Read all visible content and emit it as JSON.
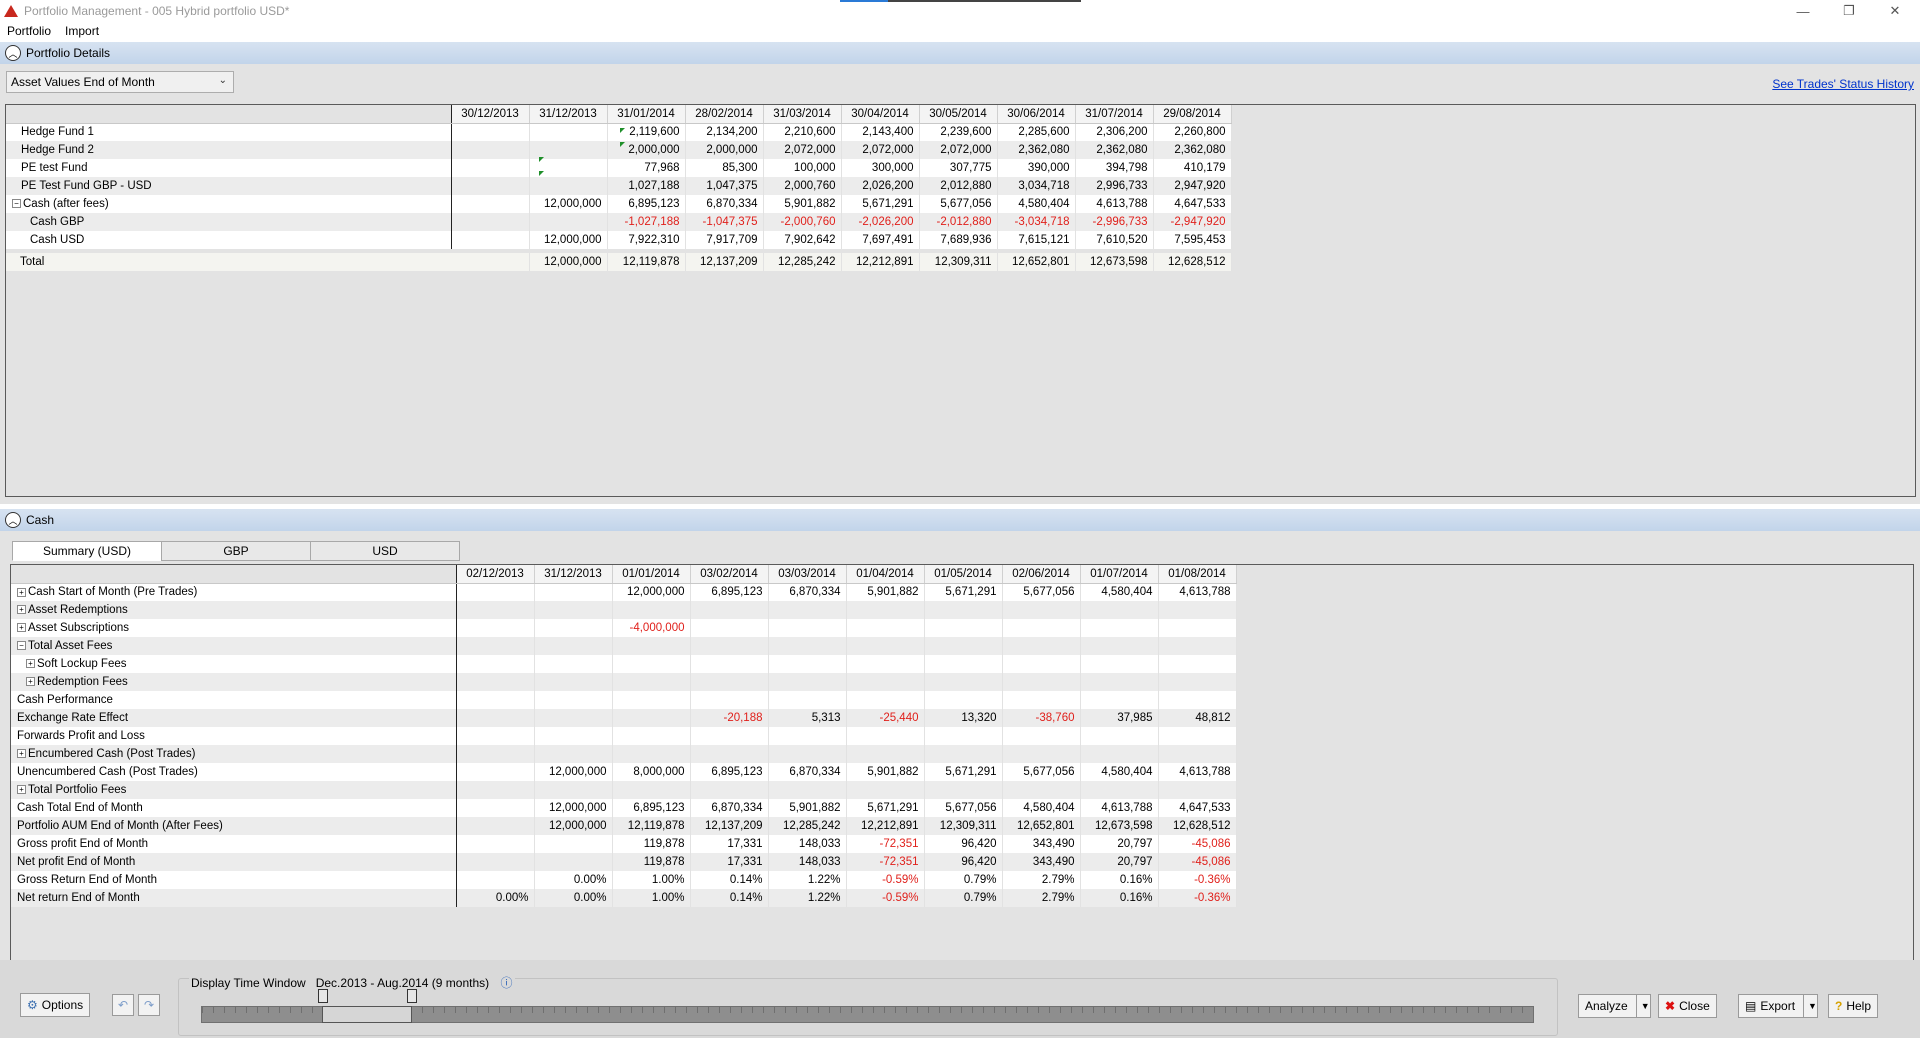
{
  "window": {
    "title": "Portfolio Management - 005 Hybrid portfolio USD*",
    "controls": {
      "minimize": "—",
      "restore": "❐",
      "close": "✕"
    }
  },
  "menu": [
    "Portfolio",
    "Import"
  ],
  "portfolio_details": {
    "header": "Portfolio Details",
    "dropdown_value": "Asset Values End of Month",
    "link": "See Trades' Status History",
    "columns": [
      "30/12/2013",
      "31/12/2013",
      "31/01/2014",
      "28/02/2014",
      "31/03/2014",
      "30/04/2014",
      "30/05/2014",
      "30/06/2014",
      "31/07/2014",
      "29/08/2014"
    ],
    "rows": [
      {
        "label": "Hedge Fund 1",
        "expander": "",
        "indent": 1,
        "values": [
          "",
          "",
          "2,119,600",
          "2,134,200",
          "2,210,600",
          "2,143,400",
          "2,239,600",
          "2,285,600",
          "2,306,200",
          "2,260,800"
        ],
        "neg": false
      },
      {
        "label": "Hedge Fund 2",
        "expander": "",
        "indent": 1,
        "values": [
          "",
          "",
          "2,000,000",
          "2,000,000",
          "2,072,000",
          "2,072,000",
          "2,072,000",
          "2,362,080",
          "2,362,080",
          "2,362,080"
        ],
        "neg": false
      },
      {
        "label": "PE test Fund",
        "expander": "",
        "indent": 1,
        "values": [
          "",
          "",
          "77,968",
          "85,300",
          "100,000",
          "300,000",
          "307,775",
          "390,000",
          "394,798",
          "410,179"
        ],
        "neg": false
      },
      {
        "label": "PE Test Fund GBP - USD",
        "expander": "",
        "indent": 1,
        "values": [
          "",
          "",
          "1,027,188",
          "1,047,375",
          "2,000,760",
          "2,026,200",
          "2,012,880",
          "3,034,718",
          "2,996,733",
          "2,947,920"
        ],
        "neg": false
      },
      {
        "label": "Cash (after fees)",
        "expander": "−",
        "indent": 0,
        "values": [
          "",
          "12,000,000",
          "6,895,123",
          "6,870,334",
          "5,901,882",
          "5,671,291",
          "5,677,056",
          "4,580,404",
          "4,613,788",
          "4,647,533"
        ],
        "neg": false
      },
      {
        "label": "Cash GBP",
        "expander": "",
        "indent": 2,
        "values": [
          "",
          "",
          "-1,027,188",
          "-1,047,375",
          "-2,000,760",
          "-2,026,200",
          "-2,012,880",
          "-3,034,718",
          "-2,996,733",
          "-2,947,920"
        ],
        "neg": true
      },
      {
        "label": "Cash USD",
        "expander": "",
        "indent": 2,
        "values": [
          "",
          "12,000,000",
          "7,922,310",
          "7,917,709",
          "7,902,642",
          "7,697,491",
          "7,689,936",
          "7,615,121",
          "7,610,520",
          "7,595,453"
        ],
        "neg": false
      }
    ],
    "total": {
      "label": "Total",
      "values": [
        "",
        "12,000,000",
        "12,119,878",
        "12,137,209",
        "12,285,242",
        "12,212,891",
        "12,309,311",
        "12,652,801",
        "12,673,598",
        "12,628,512"
      ]
    }
  },
  "cash": {
    "header": "Cash",
    "tabs": [
      "Summary (USD)",
      "GBP",
      "USD"
    ],
    "columns": [
      "02/12/2013",
      "31/12/2013",
      "01/01/2014",
      "03/02/2014",
      "03/03/2014",
      "01/04/2014",
      "01/05/2014",
      "02/06/2014",
      "01/07/2014",
      "01/08/2014"
    ],
    "rows": [
      {
        "label": "Cash Start of Month (Pre Trades)",
        "expander": "+",
        "indent": 0,
        "values": [
          "",
          "",
          "12,000,000",
          "6,895,123",
          "6,870,334",
          "5,901,882",
          "5,671,291",
          "5,677,056",
          "4,580,404",
          "4,613,788"
        ]
      },
      {
        "label": "Asset Redemptions",
        "expander": "+",
        "indent": 0,
        "values": [
          "",
          "",
          "",
          "",
          "",
          "",
          "",
          "",
          "",
          ""
        ]
      },
      {
        "label": "Asset Subscriptions",
        "expander": "+",
        "indent": 0,
        "values": [
          "",
          "",
          "-4,000,000",
          "",
          "",
          "",
          "",
          "",
          "",
          ""
        ]
      },
      {
        "label": "Total Asset Fees",
        "expander": "−",
        "indent": 0,
        "values": [
          "",
          "",
          "",
          "",
          "",
          "",
          "",
          "",
          "",
          ""
        ]
      },
      {
        "label": "Soft Lockup Fees",
        "expander": "+",
        "indent": 1,
        "values": [
          "",
          "",
          "",
          "",
          "",
          "",
          "",
          "",
          "",
          ""
        ]
      },
      {
        "label": "Redemption Fees",
        "expander": "+",
        "indent": 1,
        "values": [
          "",
          "",
          "",
          "",
          "",
          "",
          "",
          "",
          "",
          ""
        ]
      },
      {
        "label": "Cash Performance",
        "expander": "",
        "indent": 0,
        "values": [
          "",
          "",
          "",
          "",
          "",
          "",
          "",
          "",
          "",
          ""
        ]
      },
      {
        "label": "Exchange Rate Effect",
        "expander": "",
        "indent": 0,
        "values": [
          "",
          "",
          "",
          "-20,188",
          "5,313",
          "-25,440",
          "13,320",
          "-38,760",
          "37,985",
          "48,812"
        ]
      },
      {
        "label": "Forwards Profit and Loss",
        "expander": "",
        "indent": 0,
        "values": [
          "",
          "",
          "",
          "",
          "",
          "",
          "",
          "",
          "",
          ""
        ]
      },
      {
        "label": "Encumbered Cash (Post Trades)",
        "expander": "+",
        "indent": 0,
        "values": [
          "",
          "",
          "",
          "",
          "",
          "",
          "",
          "",
          "",
          ""
        ]
      },
      {
        "label": "Unencumbered Cash (Post Trades)",
        "expander": "",
        "indent": 0,
        "values": [
          "",
          "12,000,000",
          "8,000,000",
          "6,895,123",
          "6,870,334",
          "5,901,882",
          "5,671,291",
          "5,677,056",
          "4,580,404",
          "4,613,788"
        ]
      },
      {
        "label": "Total Portfolio Fees",
        "expander": "+",
        "indent": 0,
        "values": [
          "",
          "",
          "",
          "",
          "",
          "",
          "",
          "",
          "",
          ""
        ]
      },
      {
        "label": "Cash Total End of Month",
        "expander": "",
        "indent": 0,
        "values": [
          "",
          "12,000,000",
          "6,895,123",
          "6,870,334",
          "5,901,882",
          "5,671,291",
          "5,677,056",
          "4,580,404",
          "4,613,788",
          "4,647,533"
        ]
      },
      {
        "label": "Portfolio AUM End of Month (After Fees)",
        "expander": "",
        "indent": 0,
        "values": [
          "",
          "12,000,000",
          "12,119,878",
          "12,137,209",
          "12,285,242",
          "12,212,891",
          "12,309,311",
          "12,652,801",
          "12,673,598",
          "12,628,512"
        ]
      },
      {
        "label": "Gross profit End of Month",
        "expander": "",
        "indent": 0,
        "values": [
          "",
          "",
          "119,878",
          "17,331",
          "148,033",
          "-72,351",
          "96,420",
          "343,490",
          "20,797",
          "-45,086"
        ]
      },
      {
        "label": "Net profit End of Month",
        "expander": "",
        "indent": 0,
        "values": [
          "",
          "",
          "119,878",
          "17,331",
          "148,033",
          "-72,351",
          "96,420",
          "343,490",
          "20,797",
          "-45,086"
        ]
      },
      {
        "label": "Gross Return End of Month",
        "expander": "",
        "indent": 0,
        "values": [
          "",
          "0.00%",
          "1.00%",
          "0.14%",
          "1.22%",
          "-0.59%",
          "0.79%",
          "2.79%",
          "0.16%",
          "-0.36%"
        ]
      },
      {
        "label": "Net return End of Month",
        "expander": "",
        "indent": 0,
        "values": [
          "0.00%",
          "0.00%",
          "1.00%",
          "0.14%",
          "1.22%",
          "-0.59%",
          "0.79%",
          "2.79%",
          "0.16%",
          "-0.36%"
        ]
      }
    ]
  },
  "bottom": {
    "options_label": "Options",
    "time_window_label": "Display Time Window",
    "time_window_value": "Dec.2013 - Aug.2014 (9 months)",
    "analyze_label": "Analyze",
    "close_label": "Close",
    "export_label": "Export",
    "help_label": "Help"
  }
}
